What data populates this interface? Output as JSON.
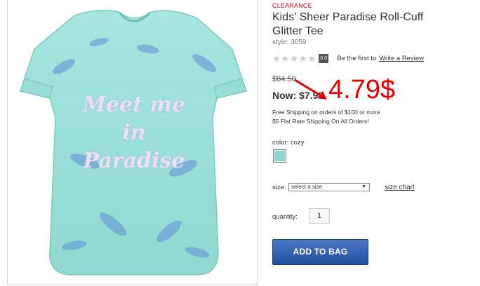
{
  "product": {
    "badge": "CLEARANCE",
    "title": "Kids' Sheer Paradise Roll-Cuff Glitter Tee",
    "style": "style: 3059",
    "image_text": "Meet me in Paradise"
  },
  "rating": {
    "score": "0.0",
    "be_first": "Be the first to",
    "write_review": "Write a Review"
  },
  "price": {
    "old": "$84.50",
    "now_label": "Now:",
    "now_value": "$7.99",
    "overlay": "4.79$"
  },
  "shipping": {
    "line1": "Free Shipping on orders of $100 or more",
    "line2": "$5 Flat Rate Shipping On All Orders!"
  },
  "color": {
    "label": "color:",
    "value": "cozy",
    "swatch_hex": "#8fd5cf"
  },
  "size": {
    "label": "size:",
    "placeholder": "select a size",
    "chart_link": "size chart"
  },
  "quantity": {
    "label": "quantity:",
    "value": "1"
  },
  "cta": {
    "add_to_bag": "ADD TO BAG"
  },
  "colors": {
    "accent_red": "#d0021b",
    "button_blue": "#2a5caa"
  }
}
